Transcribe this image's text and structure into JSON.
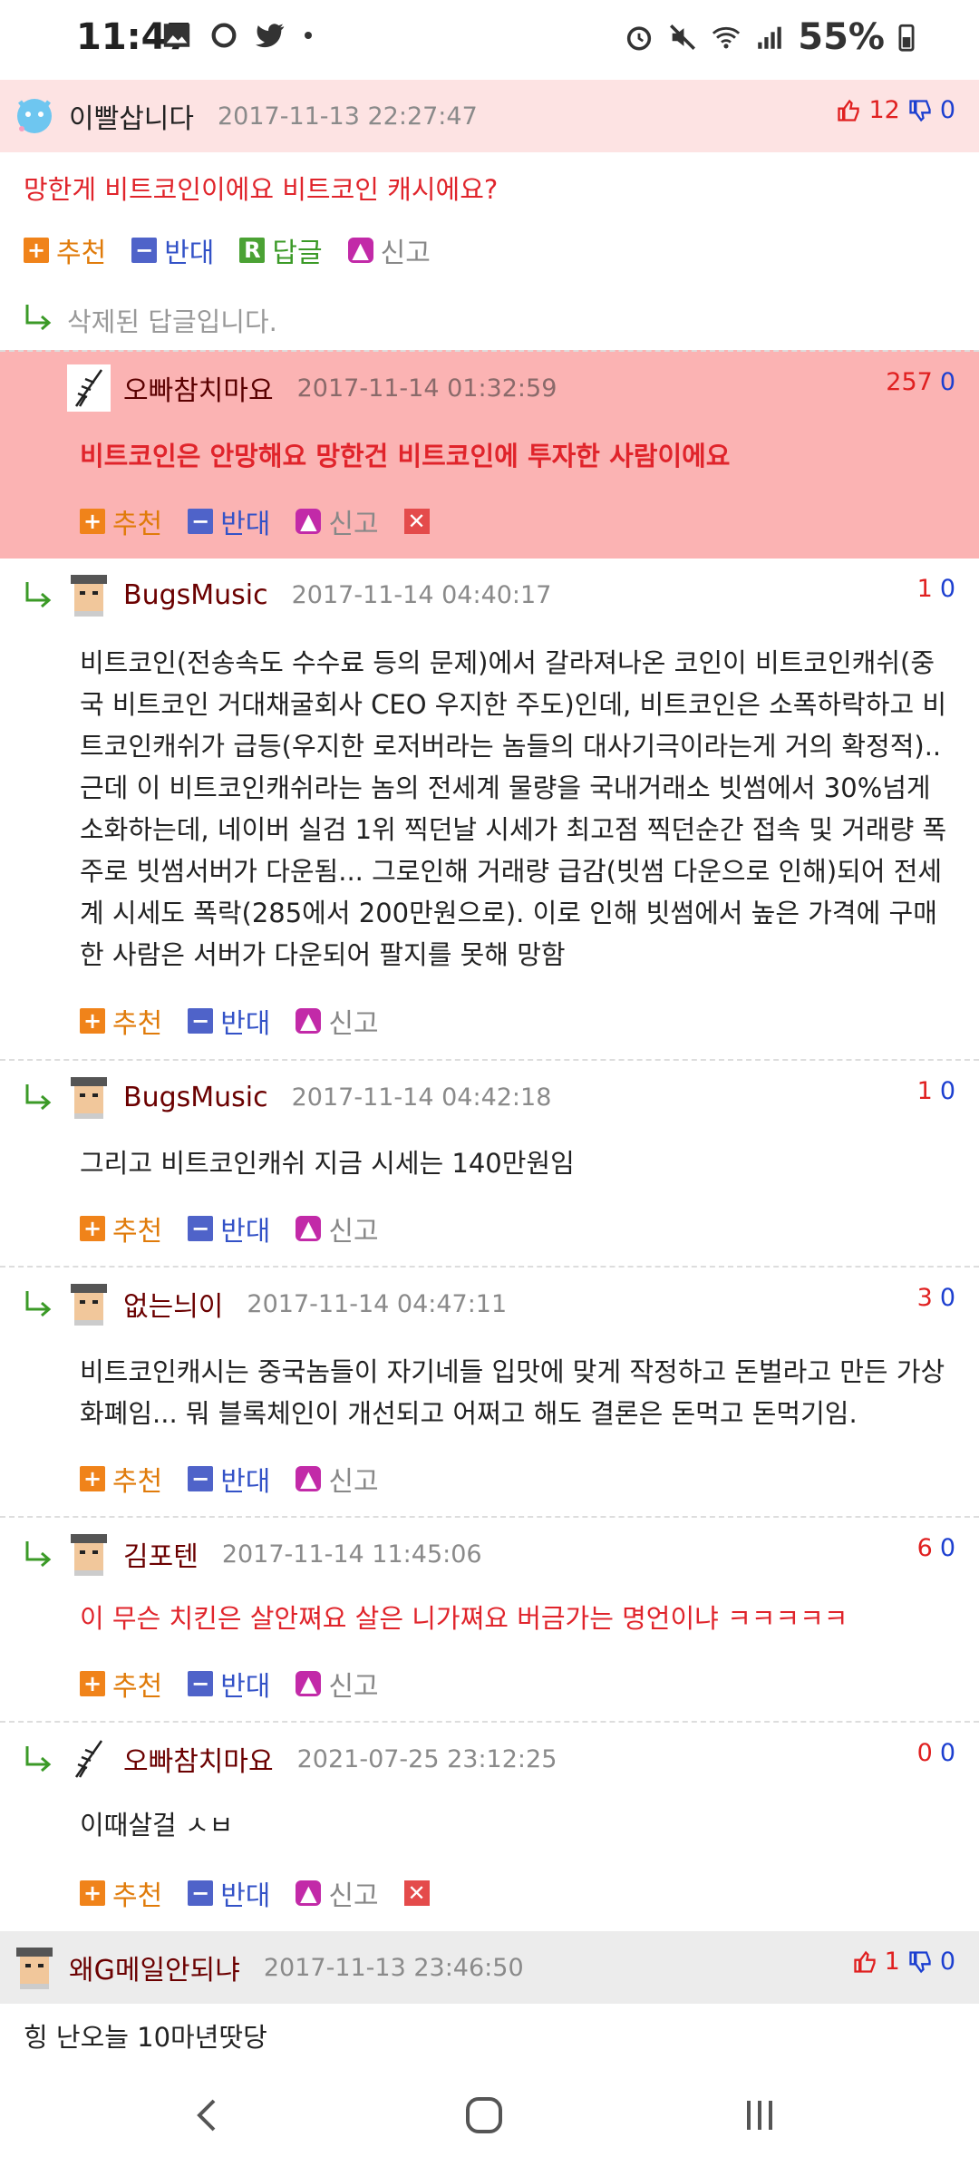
{
  "status": {
    "time": "11:47",
    "battery": "55%"
  },
  "actions": {
    "recommend": "추천",
    "oppose": "반대",
    "reply": "답글",
    "report": "신고"
  },
  "comments": [
    {
      "name": "이빨삽니다",
      "date": "2017-11-13 22:27:47",
      "up": "12",
      "down": "0",
      "text": "망한게 비트코인이에요 비트코인 캐시에요?"
    },
    {
      "deleted_text": "삭제된 답글입니다."
    },
    {
      "name": "오빠참치마요",
      "date": "2017-11-14 01:32:59",
      "up": "257",
      "down": "0",
      "text": "비트코인은 안망해요 망한건 비트코인에 투자한 사람이에요"
    },
    {
      "name": "BugsMusic",
      "date": "2017-11-14 04:40:17",
      "up": "1",
      "down": "0",
      "text": "비트코인(전송속도 수수료 등의 문제)에서 갈라져나온 코인이 비트코인캐쉬(중국 비트코인 거대채굴회사 CEO 우지한 주도)인데, 비트코인은 소폭하락하고 비트코인캐쉬가 급등(우지한 로저버라는 놈들의 대사기극이라는게 거의 확정적).. 근데 이 비트코인캐쉬라는 놈의 전세계 물량을 국내거래소 빗썸에서 30%넘게 소화하는데, 네이버 실검 1위 찍던날 시세가 최고점 찍던순간 접속 및 거래량 폭주로 빗썸서버가 다운됨... 그로인해 거래량 급감(빗썸 다운으로 인해)되어 전세계 시세도 폭락(285에서 200만원으로). 이로 인해 빗썸에서 높은 가격에 구매한 사람은 서버가 다운되어 팔지를 못해 망함"
    },
    {
      "name": "BugsMusic",
      "date": "2017-11-14 04:42:18",
      "up": "1",
      "down": "0",
      "text": "그리고 비트코인캐쉬 지금 시세는 140만원임"
    },
    {
      "name": "없는늬이",
      "date": "2017-11-14 04:47:11",
      "up": "3",
      "down": "0",
      "text": "비트코인캐시는 중국놈들이 자기네들 입맛에 맞게 작정하고 돈벌라고 만든 가상화폐임... 뭐 블록체인이 개선되고 어쩌고 해도 결론은 돈먹고 돈먹기임."
    },
    {
      "name": "김포텐",
      "date": "2017-11-14 11:45:06",
      "up": "6",
      "down": "0",
      "text": "이 무슨 치킨은 살안쪄요 살은 니가쪄요 버금가는 명언이냐 ㅋㅋㅋㅋㅋ"
    },
    {
      "name": "오빠참치마요",
      "date": "2021-07-25 23:12:25",
      "up": "0",
      "down": "0",
      "text": "이때살걸 ㅅㅂ"
    },
    {
      "name": "왜G메일안되냐",
      "date": "2017-11-13 23:46:50",
      "up": "1",
      "down": "0",
      "text": "힝 난오늘 10마년땃당"
    }
  ],
  "colors": {
    "highlight_bg": "#fde3e3",
    "best_bg": "#fbb3b3",
    "gray_head": "#ececec",
    "red_text": "#e0242b"
  }
}
